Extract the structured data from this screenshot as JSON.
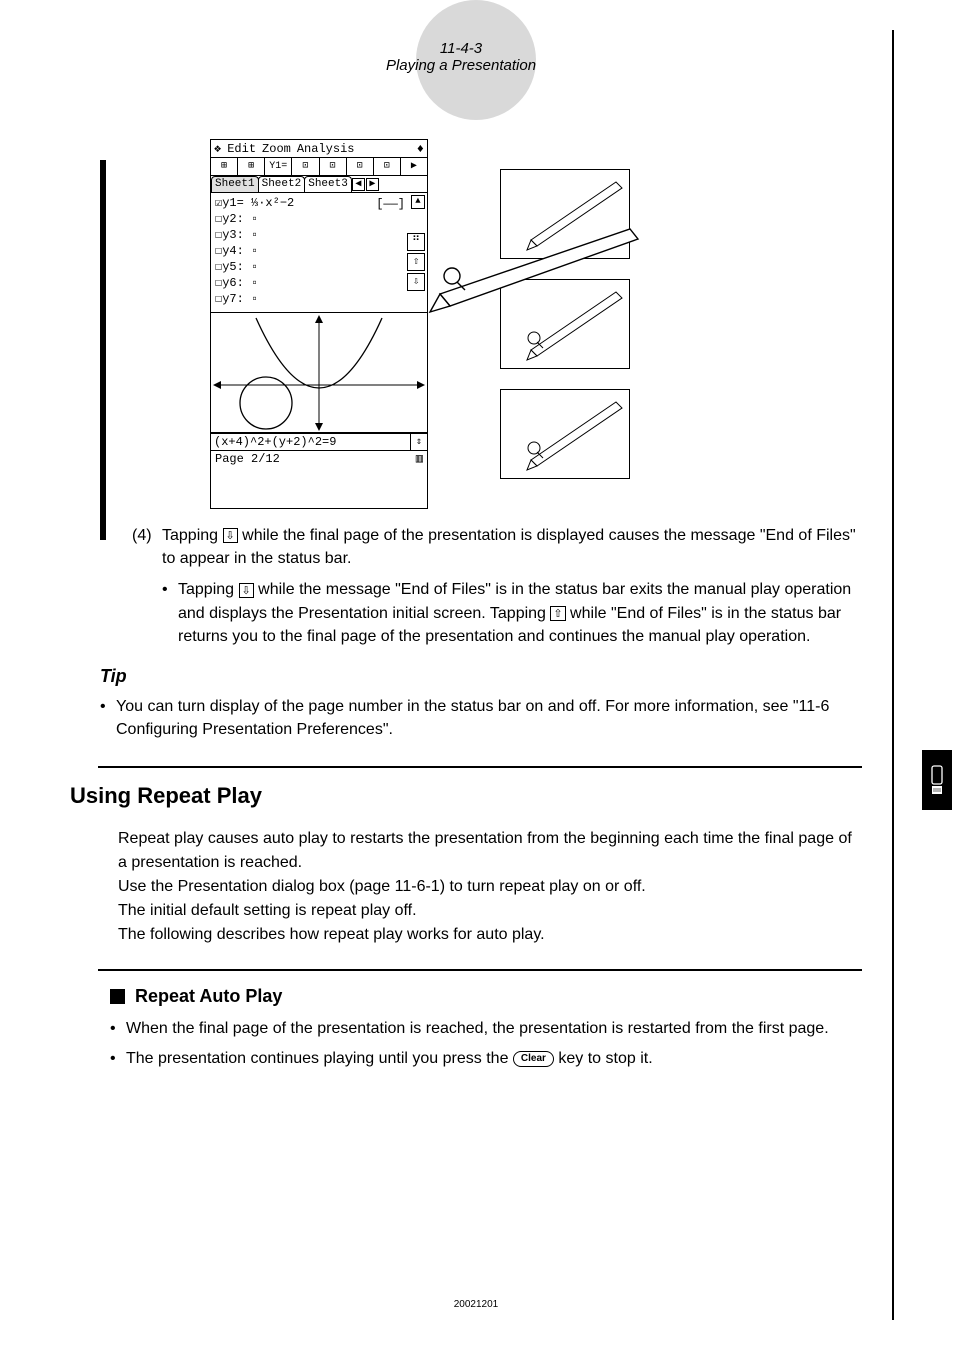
{
  "header": {
    "section_num": "11-4-3",
    "section_title": "Playing a Presentation"
  },
  "calculator": {
    "menu": {
      "edit": "Edit",
      "zoom": "Zoom",
      "analysis": "Analysis"
    },
    "toolbar": [
      "⊞",
      "⊞",
      "Y1=",
      "⊡",
      "⊡",
      "⊡",
      "⊡"
    ],
    "sheets": {
      "s1": "Sheet1",
      "s2": "Sheet2",
      "s3": "Sheet3"
    },
    "functions": {
      "y1": "☑y1= ⅓·x²−2",
      "y2": "☐y2: ▫",
      "y3": "☐y3: ▫",
      "y4": "☐y4: ▫",
      "y5": "☐y5: ▫",
      "y6": "☐y6: ▫",
      "y7": "☐y7: ▫"
    },
    "equation": "(x+4)^2+(y+2)^2=9",
    "status_page": "Page 2/12",
    "scroll_labels": {
      "dots": "⠛",
      "up": "⇧",
      "down": "⇩"
    }
  },
  "step4": {
    "num": "(4)",
    "text_a": "Tapping ",
    "text_b": " while the final page of the presentation is displayed causes the message \"End of Files\" to appear in the status bar.",
    "sub_a": "Tapping ",
    "sub_b": " while the message \"End of Files\" is in the status bar exits the manual play operation and displays the Presentation initial screen. Tapping ",
    "sub_c": " while \"End of Files\" is in the status bar returns you to the final page of the presentation and continues the manual play operation.",
    "icon_down": "⇩",
    "icon_up": "⇧"
  },
  "tip": {
    "heading": "Tip",
    "text": "You can turn display of the page number in the status bar on and off. For more information, see \"11-6 Configuring Presentation Preferences\"."
  },
  "repeat": {
    "heading": "Using Repeat Play",
    "para1": "Repeat play causes auto play to restarts the presentation from the beginning each time the final page of a presentation is reached.",
    "para2": "Use the Presentation dialog box (page 11-6-1) to turn repeat play on or off.",
    "para3": "The initial default setting is repeat play off.",
    "para4": "The following describes how repeat play works for auto play."
  },
  "autoplay": {
    "heading": "Repeat Auto Play",
    "b1": "When the final page of the presentation is reached, the presentation is restarted from the first page.",
    "b2_a": "The presentation continues playing until you press the ",
    "b2_b": " key to stop it.",
    "clear_label": "Clear"
  },
  "footer": {
    "date": "20021201"
  }
}
